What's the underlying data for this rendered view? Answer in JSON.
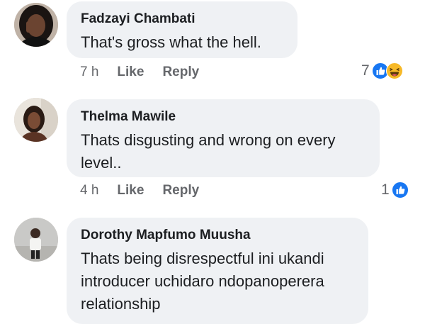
{
  "comments": [
    {
      "author": "Fadzayi Chambati",
      "text": "That's gross what the hell.",
      "time": "7 h",
      "like_label": "Like",
      "reply_label": "Reply",
      "reaction_count": "7",
      "reaction_icons": [
        "like-icon",
        "haha-icon"
      ]
    },
    {
      "author": "Thelma Mawile",
      "text_lines": [
        "Thats disgusting and wrong on every",
        "level.."
      ],
      "time": "4 h",
      "like_label": "Like",
      "reply_label": "Reply",
      "reaction_count": "1",
      "reaction_icons": [
        "like-icon"
      ]
    },
    {
      "author": "Dorothy Mapfumo Muusha",
      "text_lines": [
        "Thats being disrespectful ini ukandi",
        "introducer uchidaro ndopanoperera",
        "relationship"
      ]
    }
  ],
  "colors": {
    "bubble": "#eff1f4",
    "like_blue": "#1877f2",
    "haha_yellow": "#f7b928",
    "meta_gray": "#65676b"
  }
}
